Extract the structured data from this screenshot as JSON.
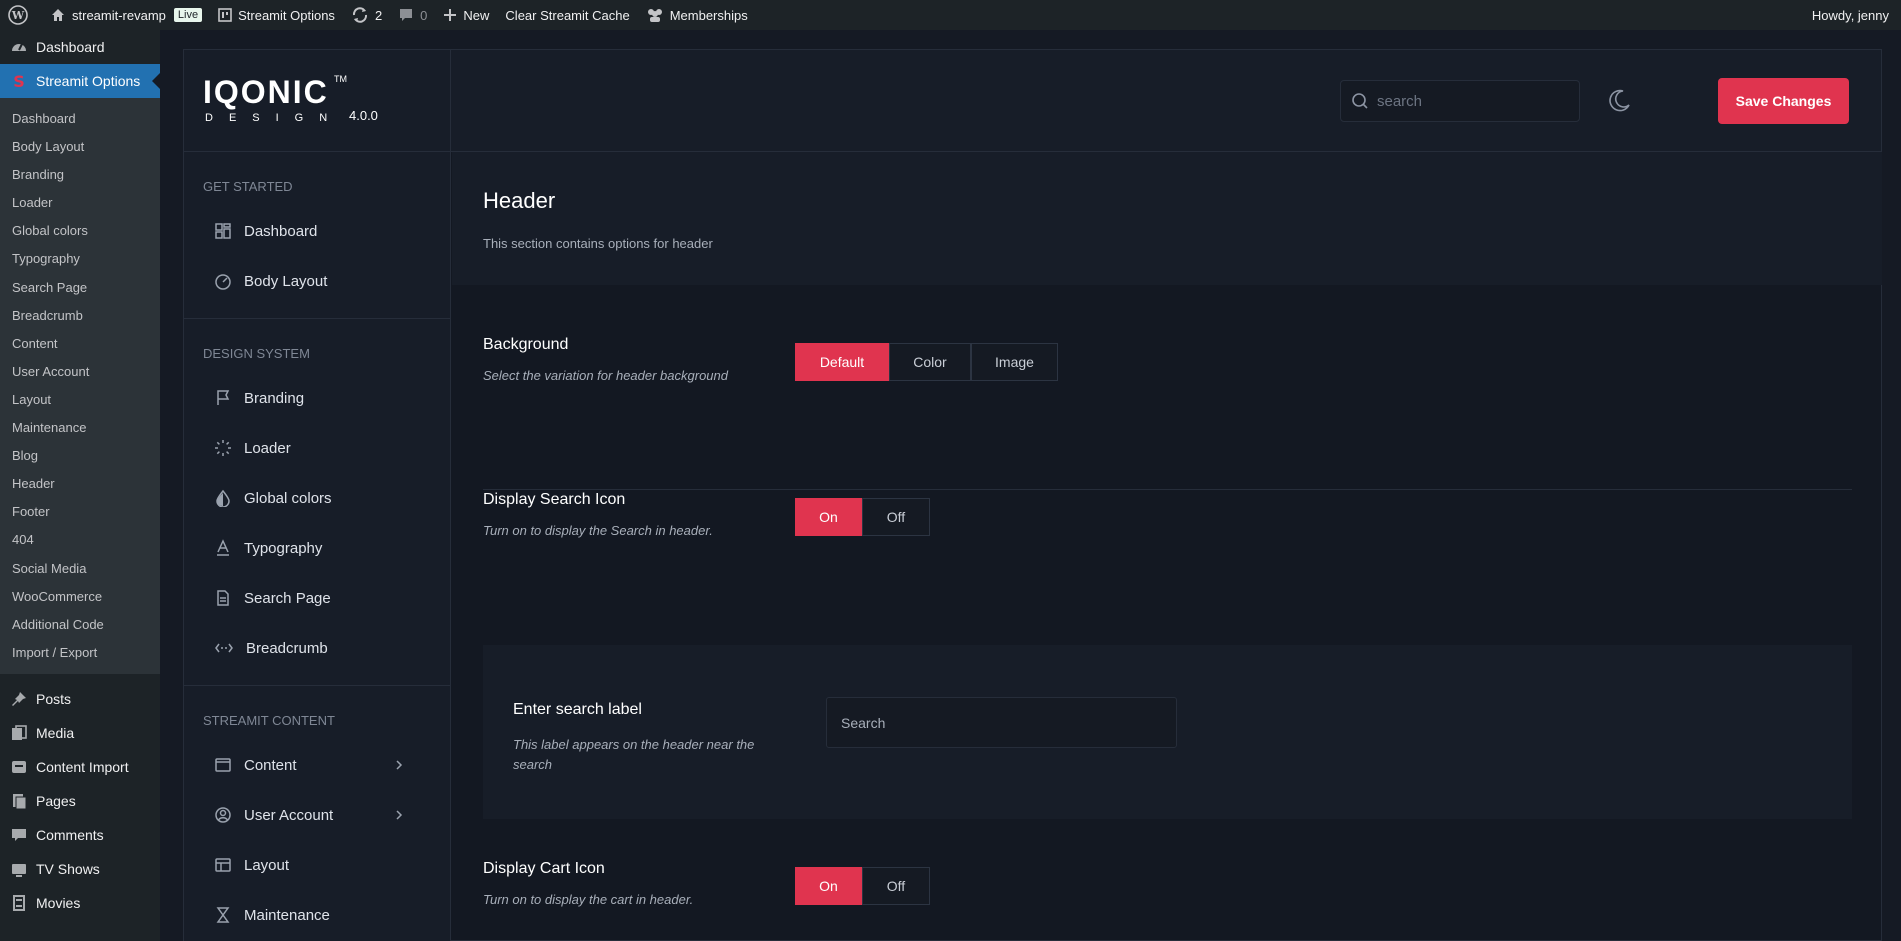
{
  "adminbar": {
    "site_name": "streamit-revamp",
    "live_badge": "Live",
    "plugin_link": "Streamit Options",
    "updates_count": "2",
    "comments_count": "0",
    "new_label": "New",
    "clear_cache": "Clear Streamit Cache",
    "memberships": "Memberships",
    "greeting": "Howdy, jenny"
  },
  "wpmenu": {
    "dashboard": "Dashboard",
    "active": "Streamit Options",
    "submenu": [
      "Dashboard",
      "Body Layout",
      "Branding",
      "Loader",
      "Global colors",
      "Typography",
      "Search Page",
      "Breadcrumb",
      "Content",
      "User Account",
      "Layout",
      "Maintenance",
      "Blog",
      "Header",
      "Footer",
      "404",
      "Social Media",
      "WooCommerce",
      "Additional Code",
      "Import / Export"
    ],
    "lower": [
      "Posts",
      "Media",
      "Content Import",
      "Pages",
      "Comments",
      "TV Shows",
      "Movies"
    ]
  },
  "logo": {
    "word": "IQONIC",
    "tm": "TM",
    "sub": "DESIGN",
    "version": "4.0.0"
  },
  "topbar": {
    "search_placeholder": "search",
    "save_label": "Save Changes"
  },
  "sidenav": {
    "groups": [
      {
        "title": "GET STARTED",
        "items": [
          "Dashboard",
          "Body Layout"
        ]
      },
      {
        "title": "DESIGN SYSTEM",
        "items": [
          "Branding",
          "Loader",
          "Global colors",
          "Typography",
          "Search Page",
          "Breadcrumb"
        ]
      },
      {
        "title": "STREAMIT CONTENT",
        "items": [
          "Content",
          "User Account",
          "Layout",
          "Maintenance"
        ]
      }
    ]
  },
  "section": {
    "title": "Header",
    "description": "This section contains options for header"
  },
  "options": {
    "background": {
      "title": "Background",
      "description": "Select the variation for header background",
      "choices": [
        "Default",
        "Color",
        "Image"
      ],
      "selected": "Default"
    },
    "search_icon": {
      "title": "Display Search Icon",
      "description": "Turn on to display the Search in header.",
      "on": "On",
      "off": "Off",
      "selected": "On"
    },
    "search_label": {
      "title": "Enter search label",
      "description": "This label appears on the header near the search",
      "value": "Search"
    },
    "cart_icon": {
      "title": "Display Cart Icon",
      "description": "Turn on to display the cart in header.",
      "on": "On",
      "off": "Off",
      "selected": "On"
    }
  },
  "colors": {
    "accent": "#e0344f",
    "wp_active": "#2271b1"
  }
}
